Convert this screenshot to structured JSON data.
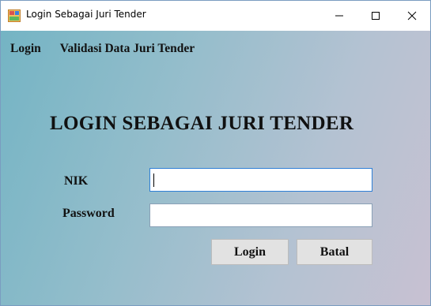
{
  "window": {
    "title": "Login Sebagai Juri Tender",
    "icon": "app-form-icon",
    "controls": {
      "minimize": "minimize-icon",
      "maximize": "maximize-icon",
      "close": "close-icon"
    }
  },
  "menu": {
    "items": [
      {
        "label": "Login"
      },
      {
        "label": "Validasi Data Juri Tender"
      }
    ]
  },
  "form": {
    "heading": "LOGIN SEBAGAI JURI TENDER",
    "nik_label": "NIK",
    "nik_value": "",
    "password_label": "Password",
    "password_value": "",
    "login_button": "Login",
    "cancel_button": "Batal"
  },
  "colors": {
    "gradient_start": "#74b4c4",
    "gradient_end": "#c8c1d2",
    "focus_border": "#2f7fd6",
    "button_bg": "#e2e2e2"
  }
}
